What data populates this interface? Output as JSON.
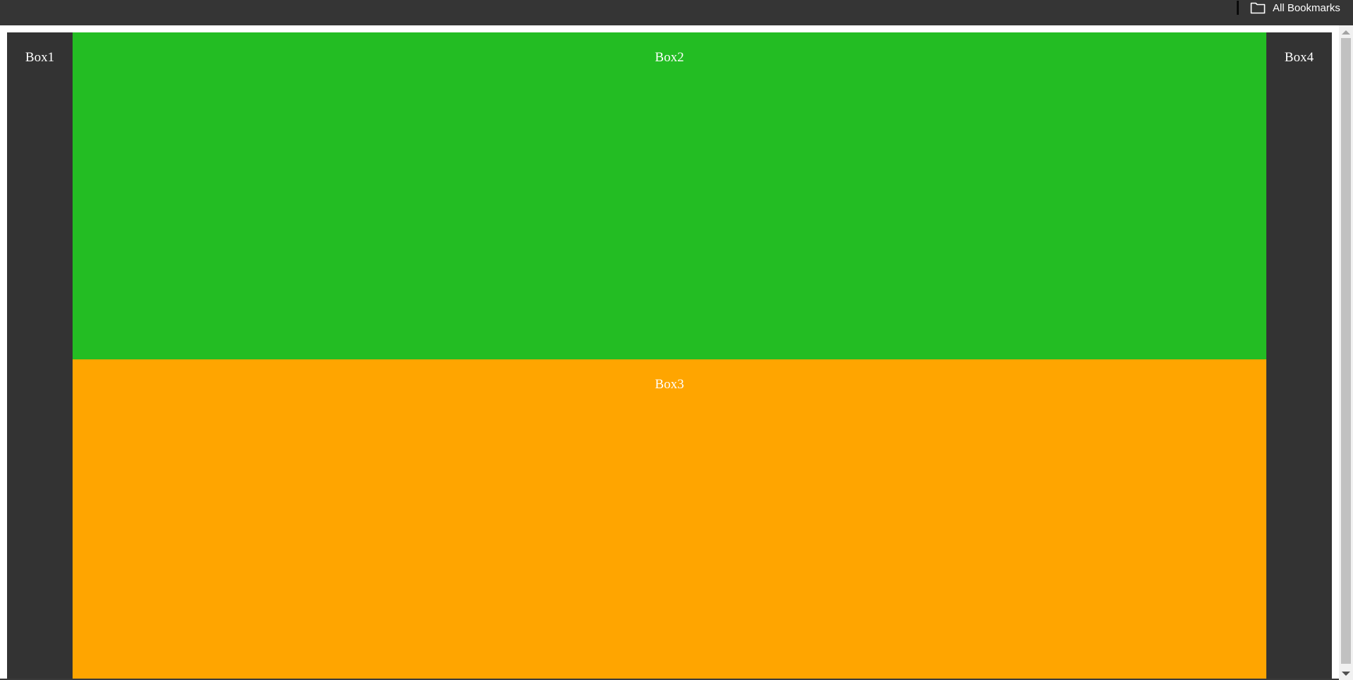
{
  "bookmarks_bar": {
    "all_bookmarks_label": "All Bookmarks",
    "icon": "folder-icon"
  },
  "page": {
    "box1": "Box1",
    "box2": "Box2",
    "box3": "Box3",
    "box4": "Box4"
  },
  "colors": {
    "toolbar": "#353535",
    "side_boxes": "#333333",
    "box2": "#23bd23",
    "box3": "#ffa500"
  }
}
